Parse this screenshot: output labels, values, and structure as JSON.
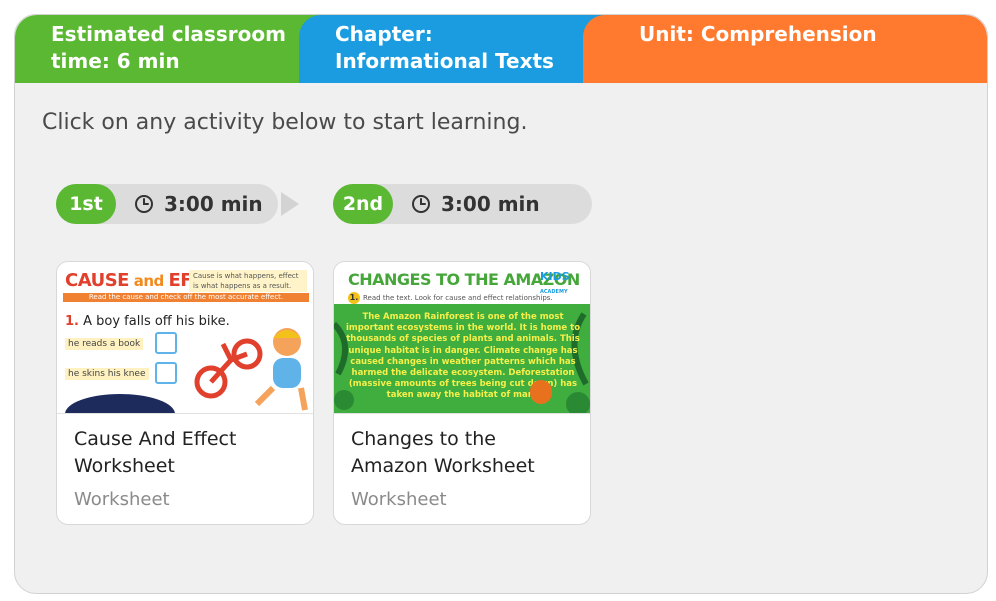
{
  "header": {
    "time": "Estimated classroom time: 6 min",
    "chapter": "Chapter: Informational Texts",
    "unit": "Unit: Comprehension"
  },
  "intro": "Click on any activity below to start learning.",
  "activities": [
    {
      "order": "1st",
      "duration": "3:00 min",
      "title": "Cause And Effect Worksheet",
      "type": "Worksheet",
      "thumb": {
        "heading_a": "CAUSE",
        "heading_and": " and ",
        "heading_b": "EFFECT",
        "note": "Cause is what happens, effect is what happens as a result.",
        "bar": "Read the cause and check off the most accurate effect.",
        "number": "1.",
        "question": "A boy falls off his bike.",
        "option1": "he reads a book",
        "option2": "he skins his knee"
      }
    },
    {
      "order": "2nd",
      "duration": "3:00 min",
      "title": "Changes to the Amazon Worksheet",
      "type": "Worksheet",
      "thumb": {
        "heading": "CHANGES TO THE AMAZON",
        "logo_a": "KIDS",
        "logo_b": "ACADEMY",
        "number": "1.",
        "instruction": "Read the text. Look for cause and effect relationships.",
        "passage": "The Amazon Rainforest is one of the most important ecosystems in the world. It is home to thousands of species of plants and animals. This unique habitat is in danger. Climate change has caused changes in weather patterns which has harmed the delicate ecosystem. Deforestation (massive amounts of trees being cut down) has taken away the habitat of many"
      }
    }
  ],
  "colors": {
    "green": "#5bb832",
    "blue": "#1b9ce0",
    "orange": "#ff7a2e"
  }
}
